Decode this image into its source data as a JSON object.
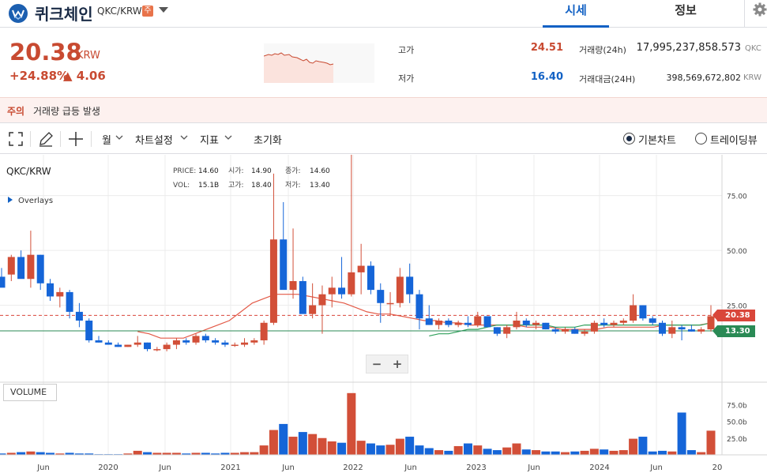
{
  "header": {
    "coin_name": "퀴크체인",
    "pair": "QKC/KRW",
    "warning_badge": "주",
    "tabs": [
      {
        "label": "시세",
        "active": true
      },
      {
        "label": "정보",
        "active": false
      }
    ]
  },
  "summary": {
    "price": "20.38",
    "unit": "KRW",
    "change_rate": "+24.88%",
    "change_amount": "▲ 4.06",
    "high_label": "고가",
    "high_value": "24.51",
    "low_label": "저가",
    "low_value": "16.40",
    "volume_label": "거래량(24h)",
    "volume_value": "17,995,237,858.573",
    "volume_unit": "QKC",
    "value_label": "거래대금(24H)",
    "value_value": "398,569,672,802",
    "value_unit": "KRW"
  },
  "caution": {
    "title": "주의",
    "message": "거래량 급등 발생"
  },
  "toolbar": {
    "interval": "월",
    "chart_settings": "차트설정",
    "indicators": "지표",
    "reset": "초기화",
    "basic_chart": "기본차트",
    "trading_view": "트레이딩뷰"
  },
  "chart_panel": {
    "symbol": "QKC/KRW",
    "overlays": "Overlays",
    "volume_label": "VOLUME",
    "zoom_out": "−",
    "zoom_in": "+",
    "ohlc": {
      "price_label": "PRICE:",
      "price": "14.60",
      "open_label": "시가:",
      "open": "14.90",
      "close_label": "종가:",
      "close": "14.60",
      "vol_label": "VOL:",
      "vol": "15.1B",
      "high_label": "고가:",
      "high": "18.40",
      "low_label": "저가:",
      "low": "13.40"
    },
    "last_price_tag": "20.38",
    "ma_tag": "13.30",
    "colors": {
      "up": "#d24f38",
      "down": "#1565d8",
      "ma_red": "#e35a47",
      "ma_green": "#2fa05a",
      "tag_green": "#2a8a55",
      "tag_red": "#d9463a"
    }
  },
  "chart_data": {
    "type": "candlestick",
    "x_tick_labels": [
      "Jun",
      "2020",
      "Jun",
      "2021",
      "Jun",
      "2022",
      "Jun",
      "2023",
      "Jun",
      "2024",
      "Jun",
      "20"
    ],
    "y_tick_labels": [
      "75.00",
      "50.00",
      "25.00"
    ],
    "y_range": [
      0,
      90
    ],
    "volume_tick_labels": [
      "75.0b",
      "50.0b",
      "25.0b"
    ],
    "volume_range_b": [
      0,
      100
    ],
    "candles": [
      {
        "o": 38,
        "h": 42,
        "l": 35,
        "c": 33,
        "v": 2
      },
      {
        "o": 39,
        "h": 48,
        "l": 36,
        "c": 47,
        "v": 3
      },
      {
        "o": 47,
        "h": 50,
        "l": 38,
        "c": 37,
        "v": 4
      },
      {
        "o": 37,
        "h": 59,
        "l": 33,
        "c": 48,
        "v": 5
      },
      {
        "o": 48,
        "h": 48,
        "l": 32,
        "c": 35,
        "v": 4
      },
      {
        "o": 35,
        "h": 37,
        "l": 27,
        "c": 29,
        "v": 3
      },
      {
        "o": 29,
        "h": 33,
        "l": 24,
        "c": 31,
        "v": 2
      },
      {
        "o": 31,
        "h": 32,
        "l": 19,
        "c": 22,
        "v": 3
      },
      {
        "o": 22,
        "h": 26,
        "l": 15,
        "c": 18,
        "v": 2
      },
      {
        "o": 18,
        "h": 19,
        "l": 8,
        "c": 9,
        "v": 2
      },
      {
        "o": 9,
        "h": 11,
        "l": 8,
        "c": 8,
        "v": 1
      },
      {
        "o": 8,
        "h": 9,
        "l": 7,
        "c": 7,
        "v": 1
      },
      {
        "o": 7,
        "h": 8,
        "l": 6,
        "c": 6,
        "v": 1
      },
      {
        "o": 6,
        "h": 7,
        "l": 6,
        "c": 7,
        "v": 2
      },
      {
        "o": 7,
        "h": 11,
        "l": 6,
        "c": 8,
        "v": 6
      },
      {
        "o": 8,
        "h": 8,
        "l": 4,
        "c": 5,
        "v": 4
      },
      {
        "o": 5,
        "h": 6,
        "l": 4,
        "c": 5,
        "v": 3
      },
      {
        "o": 5,
        "h": 8,
        "l": 4,
        "c": 7,
        "v": 3
      },
      {
        "o": 7,
        "h": 10,
        "l": 5,
        "c": 9,
        "v": 3
      },
      {
        "o": 9,
        "h": 10,
        "l": 7,
        "c": 8,
        "v": 2
      },
      {
        "o": 8,
        "h": 12,
        "l": 7,
        "c": 11,
        "v": 3
      },
      {
        "o": 11,
        "h": 12,
        "l": 8,
        "c": 9,
        "v": 3
      },
      {
        "o": 9,
        "h": 10,
        "l": 7,
        "c": 8,
        "v": 2
      },
      {
        "o": 8,
        "h": 9,
        "l": 6,
        "c": 7,
        "v": 3
      },
      {
        "o": 7,
        "h": 8,
        "l": 6,
        "c": 7,
        "v": 3
      },
      {
        "o": 7,
        "h": 10,
        "l": 6,
        "c": 8,
        "v": 4
      },
      {
        "o": 8,
        "h": 10,
        "l": 7,
        "c": 9,
        "v": 4
      },
      {
        "o": 9,
        "h": 18,
        "l": 7,
        "c": 17,
        "v": 14
      },
      {
        "o": 17,
        "h": 85,
        "l": 16,
        "c": 55,
        "v": 37
      },
      {
        "o": 55,
        "h": 72,
        "l": 35,
        "c": 32,
        "v": 46
      },
      {
        "o": 32,
        "h": 60,
        "l": 28,
        "c": 36,
        "v": 27
      },
      {
        "o": 36,
        "h": 38,
        "l": 22,
        "c": 21,
        "v": 34
      },
      {
        "o": 21,
        "h": 35,
        "l": 19,
        "c": 25,
        "v": 31
      },
      {
        "o": 25,
        "h": 34,
        "l": 12,
        "c": 30,
        "v": 25
      },
      {
        "o": 30,
        "h": 38,
        "l": 24,
        "c": 33,
        "v": 20
      },
      {
        "o": 33,
        "h": 47,
        "l": 28,
        "c": 30,
        "v": 18
      },
      {
        "o": 30,
        "h": 96,
        "l": 29,
        "c": 40,
        "v": 92
      },
      {
        "o": 40,
        "h": 53,
        "l": 30,
        "c": 43,
        "v": 21
      },
      {
        "o": 43,
        "h": 45,
        "l": 30,
        "c": 32,
        "v": 17
      },
      {
        "o": 32,
        "h": 35,
        "l": 17,
        "c": 26,
        "v": 14
      },
      {
        "o": 26,
        "h": 31,
        "l": 20,
        "c": 26,
        "v": 15
      },
      {
        "o": 26,
        "h": 42,
        "l": 24,
        "c": 38,
        "v": 24
      },
      {
        "o": 38,
        "h": 44,
        "l": 26,
        "c": 30,
        "v": 27
      },
      {
        "o": 30,
        "h": 32,
        "l": 14,
        "c": 19,
        "v": 14
      },
      {
        "o": 19,
        "h": 25,
        "l": 16,
        "c": 16,
        "v": 10
      },
      {
        "o": 16,
        "h": 19,
        "l": 14,
        "c": 18,
        "v": 7
      },
      {
        "o": 18,
        "h": 19,
        "l": 15,
        "c": 16,
        "v": 6
      },
      {
        "o": 16,
        "h": 18,
        "l": 15,
        "c": 17,
        "v": 13
      },
      {
        "o": 17,
        "h": 20,
        "l": 15,
        "c": 16,
        "v": 17
      },
      {
        "o": 16,
        "h": 22,
        "l": 15,
        "c": 20,
        "v": 14
      },
      {
        "o": 20,
        "h": 20,
        "l": 15,
        "c": 15,
        "v": 9
      },
      {
        "o": 15,
        "h": 15,
        "l": 11,
        "c": 12,
        "v": 7
      },
      {
        "o": 12,
        "h": 16,
        "l": 10,
        "c": 15,
        "v": 11
      },
      {
        "o": 15,
        "h": 22,
        "l": 14,
        "c": 18,
        "v": 17
      },
      {
        "o": 18,
        "h": 19,
        "l": 15,
        "c": 16,
        "v": 8
      },
      {
        "o": 16,
        "h": 18,
        "l": 14,
        "c": 17,
        "v": 7
      },
      {
        "o": 17,
        "h": 17,
        "l": 14,
        "c": 14,
        "v": 5
      },
      {
        "o": 14,
        "h": 15,
        "l": 12,
        "c": 13,
        "v": 5
      },
      {
        "o": 13,
        "h": 15,
        "l": 12,
        "c": 14,
        "v": 4
      },
      {
        "o": 14,
        "h": 15,
        "l": 12,
        "c": 12,
        "v": 5
      },
      {
        "o": 12,
        "h": 14,
        "l": 11,
        "c": 13,
        "v": 6
      },
      {
        "o": 13,
        "h": 18,
        "l": 12,
        "c": 17,
        "v": 9
      },
      {
        "o": 17,
        "h": 19,
        "l": 15,
        "c": 16,
        "v": 8
      },
      {
        "o": 16,
        "h": 18,
        "l": 15,
        "c": 17,
        "v": 6
      },
      {
        "o": 17,
        "h": 19,
        "l": 16,
        "c": 18,
        "v": 7
      },
      {
        "o": 18,
        "h": 30,
        "l": 17,
        "c": 25,
        "v": 24
      },
      {
        "o": 25,
        "h": 25,
        "l": 18,
        "c": 19,
        "v": 27
      },
      {
        "o": 19,
        "h": 20,
        "l": 16,
        "c": 17,
        "v": 5
      },
      {
        "o": 17,
        "h": 18,
        "l": 11,
        "c": 12,
        "v": 6
      },
      {
        "o": 12,
        "h": 18,
        "l": 10,
        "c": 15,
        "v": 5
      },
      {
        "o": 15,
        "h": 16,
        "l": 9,
        "c": 14,
        "v": 63
      },
      {
        "o": 14,
        "h": 16,
        "l": 13,
        "c": 13,
        "v": 7
      },
      {
        "o": 13,
        "h": 15,
        "l": 12,
        "c": 14,
        "v": 4
      },
      {
        "o": 14,
        "h": 25,
        "l": 13,
        "c": 20,
        "v": 36
      }
    ],
    "ma_red": [
      13,
      12,
      10,
      10,
      10,
      12,
      14,
      16,
      18,
      22,
      26,
      28,
      30,
      30,
      30,
      29,
      28,
      27,
      26,
      24,
      22,
      21,
      21,
      20,
      19,
      18,
      18,
      17,
      17,
      16,
      16,
      16,
      16,
      16,
      15,
      15,
      15,
      14,
      14,
      14,
      14,
      15,
      15,
      15,
      15,
      15,
      16,
      16,
      16,
      16,
      17
    ],
    "ma_green": [
      11,
      12,
      12,
      13,
      14,
      14,
      15,
      16,
      16,
      16,
      16,
      16,
      16,
      15,
      15,
      15,
      16,
      16,
      16,
      16,
      16,
      16,
      16,
      16,
      16,
      16,
      16,
      16,
      16,
      17
    ]
  }
}
